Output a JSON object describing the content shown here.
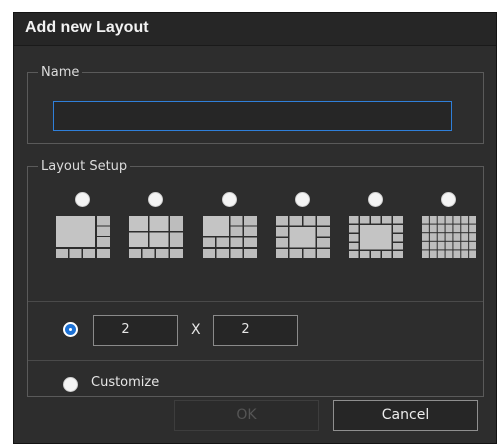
{
  "dialog": {
    "title": "Add new Layout"
  },
  "name_group": {
    "legend": "Name",
    "input_value": "",
    "input_placeholder": ""
  },
  "layout_setup": {
    "legend": "Layout Setup",
    "presets": [
      {
        "icon": "layout-1-plus-7-icon",
        "selected": false
      },
      {
        "icon": "layout-4-plus-6-icon",
        "selected": false
      },
      {
        "icon": "layout-1-plus-12-icon",
        "selected": false
      },
      {
        "icon": "layout-1-plus-15-icon",
        "selected": false
      },
      {
        "icon": "layout-1-plus-20-icon",
        "selected": false
      },
      {
        "icon": "layout-grid-35-icon",
        "selected": false
      }
    ],
    "custom_grid": {
      "selected": true,
      "columns": "2",
      "separator": "X",
      "rows": "2"
    },
    "customize": {
      "selected": false,
      "label": "Customize"
    }
  },
  "buttons": {
    "ok_label": "OK",
    "cancel_label": "Cancel"
  },
  "colors": {
    "background": "#2d2d2d",
    "accent": "#1d72d6",
    "input_border_focus": "#2f7fd9"
  }
}
